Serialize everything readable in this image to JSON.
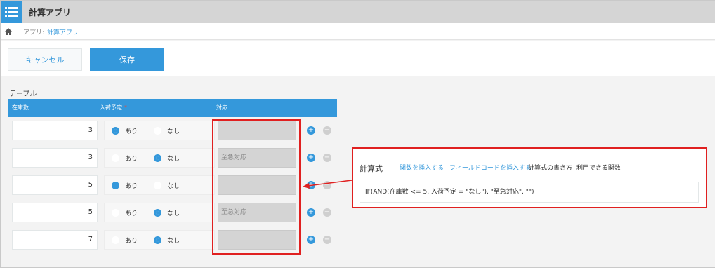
{
  "app": {
    "title": "計算アプリ",
    "icon": "list-icon"
  },
  "breadcrumb": {
    "home_icon": "home-icon",
    "prefix": "アプリ:",
    "current": "計算アプリ"
  },
  "toolbar": {
    "cancel_label": "キャンセル",
    "save_label": "保存"
  },
  "table": {
    "label": "テーブル",
    "headers": {
      "stock": "在庫数",
      "incoming": "入荷予定",
      "incoming_required_mark": "*",
      "response": "対応"
    },
    "radio_options": [
      "あり",
      "なし"
    ],
    "rows": [
      {
        "stock": "3",
        "incoming": "あり",
        "response": ""
      },
      {
        "stock": "3",
        "incoming": "なし",
        "response": "至急対応"
      },
      {
        "stock": "5",
        "incoming": "あり",
        "response": ""
      },
      {
        "stock": "5",
        "incoming": "なし",
        "response": "至急対応"
      },
      {
        "stock": "7",
        "incoming": "なし",
        "response": ""
      }
    ],
    "add_icon": "plus-circle-icon",
    "remove_icon": "minus-circle-icon"
  },
  "formula_popup": {
    "title": "計算式",
    "insert_function": "関数を挿入する",
    "insert_field_code": "フィールドコードを挿入する",
    "how_to_write": "計算式の書き方",
    "available_functions": "利用できる関数",
    "formula": "IF(AND(在庫数 <= 5, 入荷予定 = \"なし\"), \"至急対応\", \"\")"
  },
  "colors": {
    "accent": "#3498db",
    "highlight": "#e02020",
    "appbar": "#d5d5d5"
  }
}
